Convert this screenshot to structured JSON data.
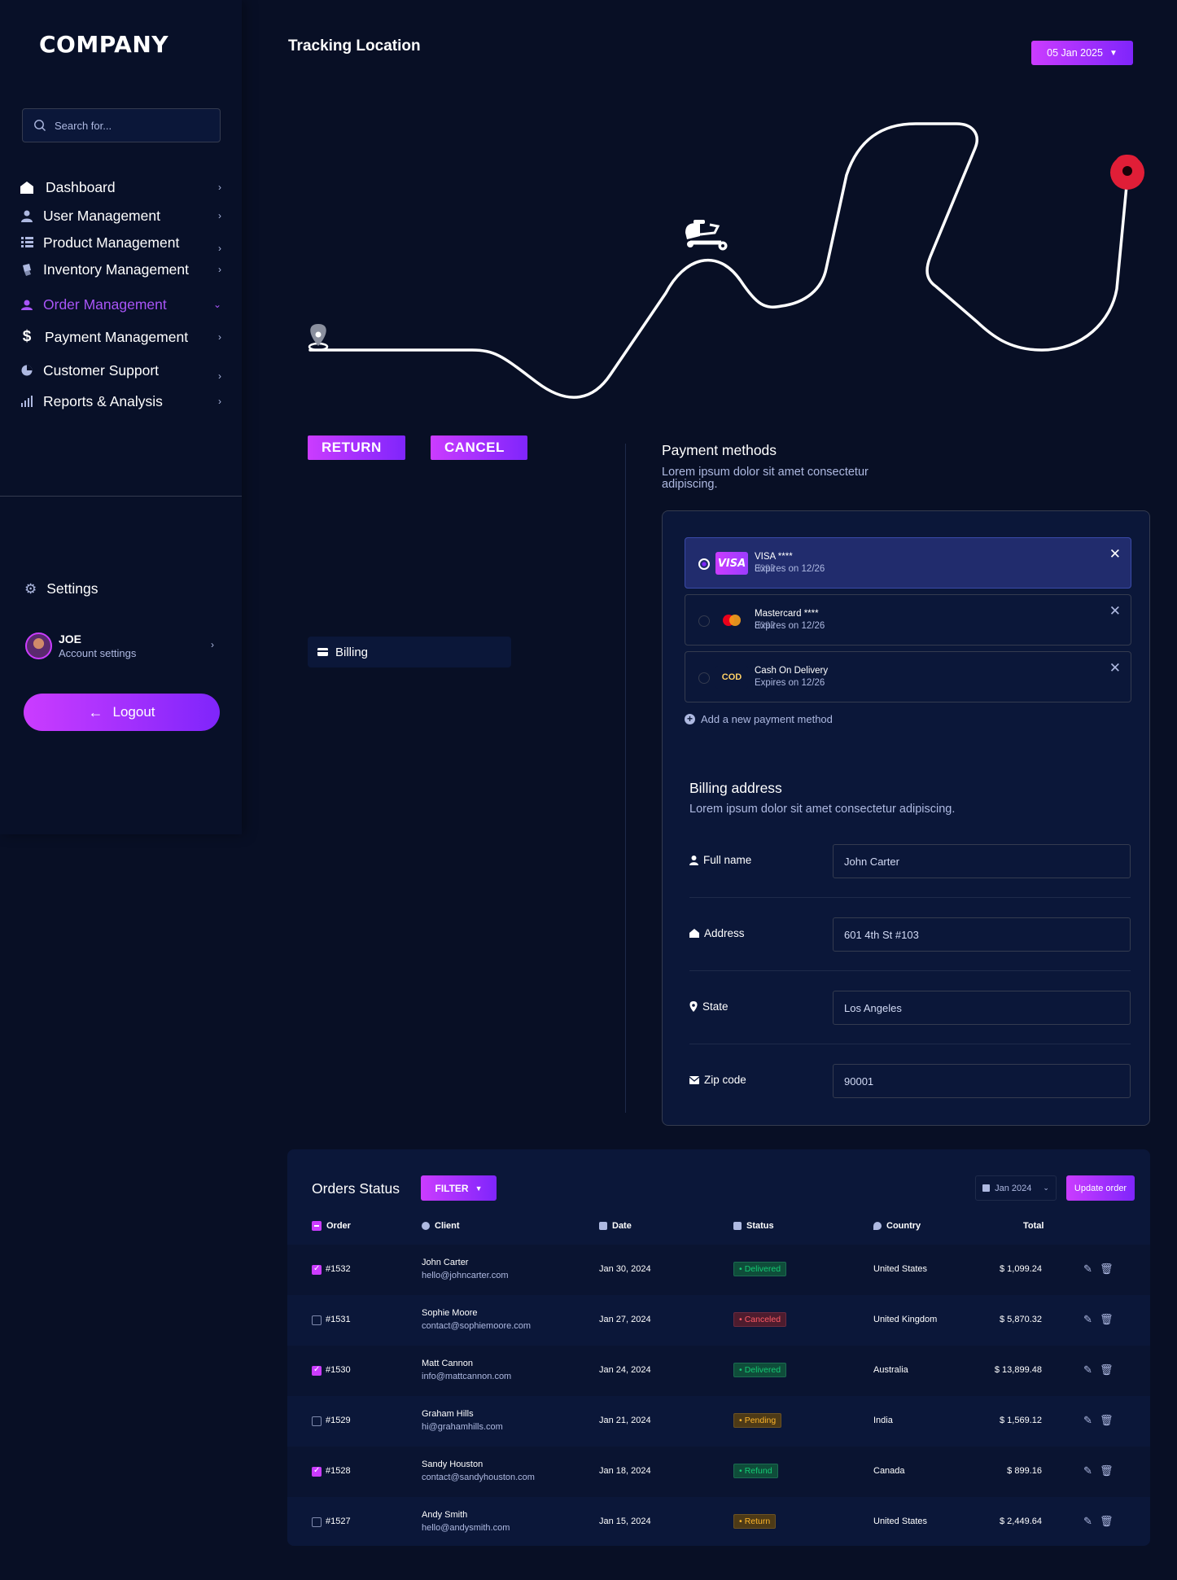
{
  "sidebar": {
    "logo": "COMPANY",
    "search_placeholder": "Search for...",
    "items": [
      {
        "label": "Dashboard",
        "icon": "home-icon"
      },
      {
        "label": "User Management",
        "icon": "user-icon"
      },
      {
        "label": "Product Management",
        "icon": "product-icon"
      },
      {
        "label": "Inventory Management",
        "icon": "inventory-icon"
      },
      {
        "label": "Order Management",
        "icon": "order-icon",
        "active": true
      },
      {
        "label": "Payment Management",
        "icon": "dollar-icon"
      },
      {
        "label": "Customer Support",
        "icon": "support-icon"
      },
      {
        "label": "Reports & Analysis",
        "icon": "chart-icon"
      }
    ],
    "settings_label": "Settings",
    "account": {
      "name": "JOE",
      "sub": "Account settings"
    },
    "logout_label": "Logout"
  },
  "header": {
    "title": "Tracking Location",
    "date": "05 Jan  2025"
  },
  "actions": {
    "return_label": "RETURN",
    "cancel_label": "CANCEL",
    "billing_tab": "Billing"
  },
  "payment": {
    "title": "Payment methods",
    "description": "Lorem ipsum dolor sit amet consectetur adipiscing.",
    "cards": [
      {
        "brand": "VISA",
        "title": "VISA ****",
        "number": "8092",
        "sub": "Expires on 12/26",
        "selected": true
      },
      {
        "brand": "Mastercard",
        "title": "Mastercard ****",
        "number": "8092",
        "sub": "Expires on 12/26",
        "selected": false
      },
      {
        "brand": "COD",
        "title": "Cash On Delivery",
        "sub": "Expires on 12/26",
        "selected": false
      }
    ],
    "add_label": "Add a new payment method"
  },
  "billing": {
    "title": "Billing address",
    "description": "Lorem ipsum dolor sit amet consectetur adipiscing.",
    "fields": [
      {
        "label": "Full name",
        "value": "John Carter"
      },
      {
        "label": "Address",
        "value": "601 4th St #103"
      },
      {
        "label": "State",
        "value": "Los Angeles"
      },
      {
        "label": "Zip code",
        "value": "90001"
      }
    ]
  },
  "orders": {
    "title": "Orders Status",
    "filter_label": "FILTER",
    "date_label": "Jan 2024",
    "update_label": "Update order",
    "columns": [
      "Order",
      "Client",
      "Date",
      "Status",
      "Country",
      "Total"
    ],
    "rows": [
      {
        "order": "#1532",
        "checked": true,
        "client": "John Carter",
        "email": "hello@johncarter.com",
        "date": "Jan 30, 2024",
        "status": "Delivered",
        "status_key": "delivered",
        "country": "United States",
        "total": "$ 1,099.24"
      },
      {
        "order": "#1531",
        "checked": false,
        "client": "Sophie Moore",
        "email": "contact@sophiemoore.com",
        "date": "Jan 27, 2024",
        "status": "Canceled",
        "status_key": "canceled",
        "country": "United Kingdom",
        "total": "$ 5,870.32"
      },
      {
        "order": "#1530",
        "checked": true,
        "client": "Matt Cannon",
        "email": "info@mattcannon.com",
        "date": "Jan 24, 2024",
        "status": "Delivered",
        "status_key": "delivered",
        "country": "Australia",
        "total": "$ 13,899.48"
      },
      {
        "order": "#1529",
        "checked": false,
        "client": "Graham Hills",
        "email": "hi@grahamhills.com",
        "date": "Jan 21, 2024",
        "status": "Pending",
        "status_key": "pending",
        "country": "India",
        "total": "$ 1,569.12"
      },
      {
        "order": "#1528",
        "checked": true,
        "client": "Sandy Houston",
        "email": "contact@sandyhouston.com",
        "date": "Jan 18, 2024",
        "status": "Refund",
        "status_key": "refund",
        "country": "Canada",
        "total": "$ 899.16"
      },
      {
        "order": "#1527",
        "checked": false,
        "client": "Andy Smith",
        "email": "hello@andysmith.com",
        "date": "Jan 15, 2024",
        "status": "Return",
        "status_key": "return",
        "country": "United States",
        "total": "$ 2,449.64"
      }
    ]
  },
  "colors": {
    "accent": "#cb3cff",
    "accent2": "#7f25fb",
    "bg": "#080f25",
    "panel": "#0b1739",
    "active_nav": "#a855f7",
    "pin": "#e01e37"
  }
}
